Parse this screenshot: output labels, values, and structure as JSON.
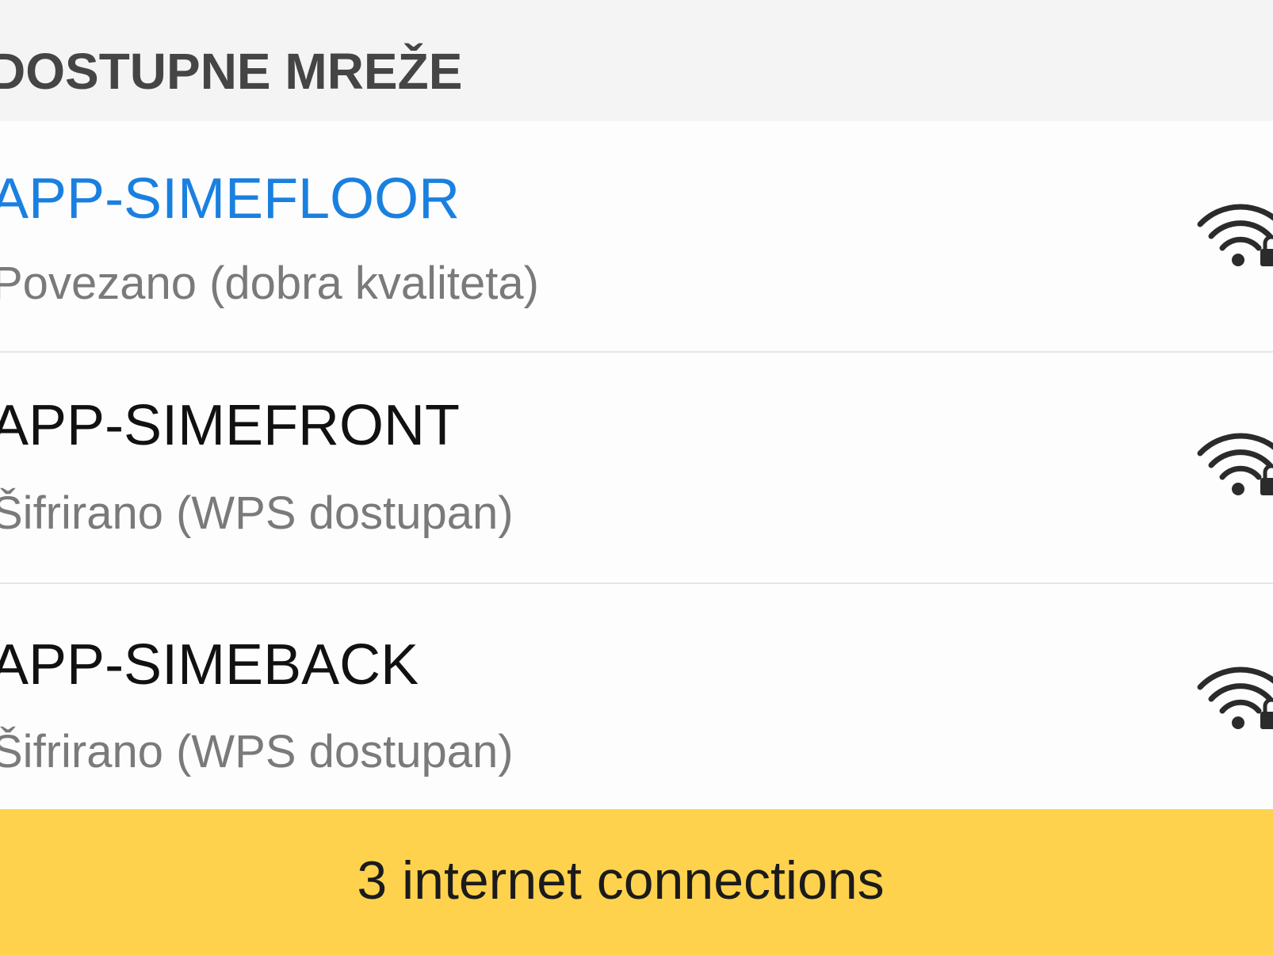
{
  "section": {
    "title": "DOSTUPNE MREŽE"
  },
  "networks": [
    {
      "ssid": "APP-SIMEFLOOR",
      "status": "Povezano (dobra kvaliteta)",
      "connected": true,
      "signal_icon": "wifi-lock-icon",
      "accent_color": "#1a80e0"
    },
    {
      "ssid": "APP-SIMEFRONT",
      "status": "Šifrirano (WPS dostupan)",
      "connected": false,
      "signal_icon": "wifi-lock-icon"
    },
    {
      "ssid": "APP-SIMEBACK",
      "status": "Šifrirano (WPS dostupan)",
      "connected": false,
      "signal_icon": "wifi-lock-icon"
    }
  ],
  "footer": {
    "text": "3 internet connections",
    "background_color": "#ffd24d"
  }
}
